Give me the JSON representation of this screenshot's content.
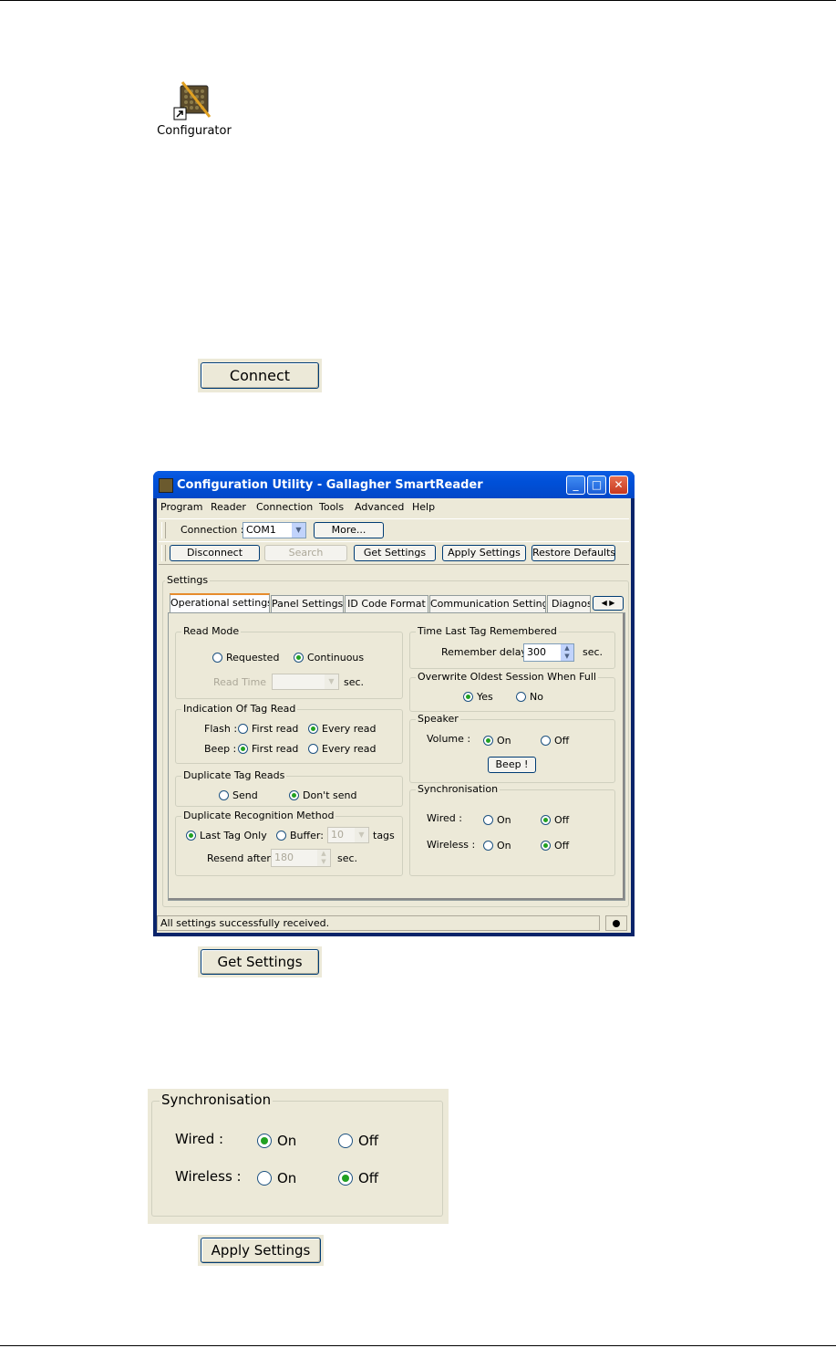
{
  "desktop_icon": {
    "label": "Configurator",
    "icon": "configurator-icon"
  },
  "connect_button": {
    "label": "Connect"
  },
  "window": {
    "title": "Configuration Utility - Gallagher SmartReader",
    "menu": [
      "Program",
      "Reader",
      "Connection",
      "Tools",
      "Advanced",
      "Help"
    ],
    "connection": {
      "label": "Connection :",
      "value": "COM1",
      "more_label": "More..."
    },
    "toolbar_buttons": {
      "disconnect": "Disconnect",
      "search": "Search",
      "get_settings": "Get Settings",
      "apply_settings": "Apply Settings",
      "restore_defaults": "Restore Defaults"
    },
    "settings_title": "Settings",
    "tabs": [
      "Operational settings",
      "Panel Settings",
      "ID Code Format",
      "Communication Settings",
      "Diagnos"
    ],
    "read_mode": {
      "title": "Read Mode",
      "requested": "Requested",
      "continuous": "Continuous",
      "selected": "Continuous",
      "read_time_label": "Read Time",
      "read_time_unit": "sec."
    },
    "indication": {
      "title": "Indication Of Tag Read",
      "flash_label": "Flash :",
      "beep_label": "Beep :",
      "first_read": "First read",
      "every_read": "Every read",
      "flash_selected": "Every read",
      "beep_selected": "First read"
    },
    "duplicate_reads": {
      "title": "Duplicate Tag Reads",
      "send": "Send",
      "dont_send": "Don't send",
      "selected": "Don't send"
    },
    "duplicate_method": {
      "title": "Duplicate Recognition Method",
      "last_tag_only": "Last Tag Only",
      "buffer": "Buffer:",
      "buffer_value": "10",
      "buffer_unit": "tags",
      "selected": "Last Tag Only",
      "resend_label": "Resend after",
      "resend_value": "180",
      "resend_unit": "sec."
    },
    "time_last_tag": {
      "title": "Time Last Tag Remembered",
      "label": "Remember delay",
      "value": "300",
      "unit": "sec."
    },
    "overwrite": {
      "title": "Overwrite Oldest Session When Full",
      "yes": "Yes",
      "no": "No",
      "selected": "Yes"
    },
    "speaker": {
      "title": "Speaker",
      "volume_label": "Volume :",
      "on": "On",
      "off": "Off",
      "selected": "On",
      "beep_button": "Beep !"
    },
    "synchronisation": {
      "title": "Synchronisation",
      "wired_label": "Wired :",
      "wireless_label": "Wireless :",
      "on": "On",
      "off": "Off",
      "wired_selected": "Off",
      "wireless_selected": "Off"
    },
    "status": "All settings successfully received."
  },
  "get_settings_button": {
    "label": "Get Settings"
  },
  "zoom_sync": {
    "title": "Synchronisation",
    "wired_label": "Wired :",
    "wireless_label": "Wireless :",
    "on": "On",
    "off": "Off",
    "wired_selected": "On",
    "wireless_selected": "Off"
  },
  "apply_settings_button": {
    "label": "Apply Settings"
  }
}
